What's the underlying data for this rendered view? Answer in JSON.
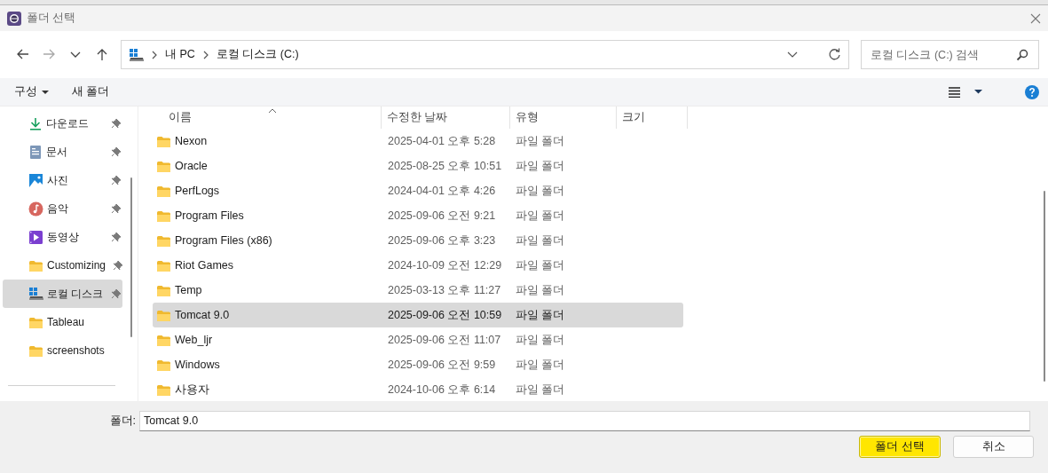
{
  "window": {
    "title": "폴더 선택"
  },
  "nav_buttons": [
    {
      "kind": "back",
      "disabled": false
    },
    {
      "kind": "forward",
      "disabled": true
    },
    {
      "kind": "recent",
      "disabled": false
    },
    {
      "kind": "up",
      "disabled": false
    }
  ],
  "address": {
    "path": [
      "내 PC",
      "로컬 디스크 (C:)"
    ]
  },
  "search": {
    "placeholder": "로컬 디스크 (C:) 검색"
  },
  "toolbar": {
    "organize": "구성",
    "new_folder": "새 폴더"
  },
  "sidebar": {
    "items": [
      {
        "label": "다운로드",
        "kind": "download",
        "pinned": true,
        "selected": false
      },
      {
        "label": "문서",
        "kind": "documents",
        "pinned": true,
        "selected": false
      },
      {
        "label": "사진",
        "kind": "pictures",
        "pinned": true,
        "selected": false
      },
      {
        "label": "음악",
        "kind": "music",
        "pinned": true,
        "selected": false
      },
      {
        "label": "동영상",
        "kind": "videos",
        "pinned": true,
        "selected": false
      },
      {
        "label": "Customizing",
        "kind": "folder",
        "pinned": true,
        "selected": false
      },
      {
        "label": "로컬 디스크",
        "kind": "drive",
        "pinned": true,
        "selected": true
      },
      {
        "label": "Tableau",
        "kind": "folder",
        "pinned": false,
        "selected": false
      },
      {
        "label": "screenshots",
        "kind": "folder",
        "pinned": false,
        "selected": false
      }
    ]
  },
  "file_list": {
    "columns": [
      "이름",
      "수정한 날짜",
      "유형",
      "크기"
    ],
    "rows": [
      {
        "name": "Nexon",
        "modified": "2025-04-01 오후 5:28",
        "type": "파일 폴더",
        "selected": false
      },
      {
        "name": "Oracle",
        "modified": "2025-08-25 오후 10:51",
        "type": "파일 폴더",
        "selected": false
      },
      {
        "name": "PerfLogs",
        "modified": "2024-04-01 오후 4:26",
        "type": "파일 폴더",
        "selected": false
      },
      {
        "name": "Program Files",
        "modified": "2025-09-06 오전 9:21",
        "type": "파일 폴더",
        "selected": false
      },
      {
        "name": "Program Files (x86)",
        "modified": "2025-09-06 오후 3:23",
        "type": "파일 폴더",
        "selected": false
      },
      {
        "name": "Riot Games",
        "modified": "2024-10-09 오전 12:29",
        "type": "파일 폴더",
        "selected": false
      },
      {
        "name": "Temp",
        "modified": "2025-03-13 오후 11:27",
        "type": "파일 폴더",
        "selected": false
      },
      {
        "name": "Tomcat 9.0",
        "modified": "2025-09-06 오전 10:59",
        "type": "파일 폴더",
        "selected": true
      },
      {
        "name": "Web_ljr",
        "modified": "2025-09-06 오전 11:07",
        "type": "파일 폴더",
        "selected": false
      },
      {
        "name": "Windows",
        "modified": "2025-09-06 오전 9:59",
        "type": "파일 폴더",
        "selected": false
      },
      {
        "name": "사용자",
        "modified": "2024-10-06 오후 6:14",
        "type": "파일 폴더",
        "selected": false
      }
    ]
  },
  "folder_field": {
    "label": "폴더:",
    "value": "Tomcat 9.0"
  },
  "buttons": [
    {
      "label": "폴더 선택",
      "kind": "primary"
    },
    {
      "label": "취소",
      "kind": "secondary"
    }
  ]
}
